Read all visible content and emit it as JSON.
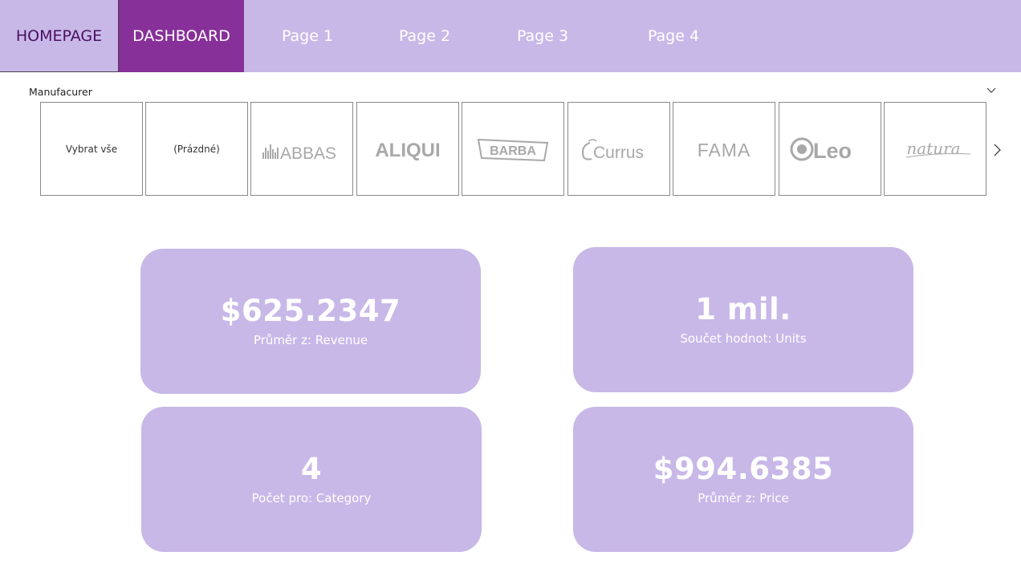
{
  "nav": {
    "home": "HOMEPAGE",
    "dashboard": "DASHBOARD",
    "pages": [
      "Page 1",
      "Page 2",
      "Page 3",
      "Page 4"
    ]
  },
  "slicer": {
    "title": "Manufacurer",
    "select_all": "Vybrat vše",
    "empty": "(Prázdné)",
    "brands": [
      "ABBAS",
      "ALIQUI",
      "BARBA",
      "Currus",
      "FAMA",
      "Leo",
      "natura"
    ]
  },
  "cards": [
    {
      "value": "$625.2347",
      "label": "Průměr z: Revenue"
    },
    {
      "value": "1 mil.",
      "label": "Součet hodnot: Units"
    },
    {
      "value": "4",
      "label": "Počet pro: Category"
    },
    {
      "value": "$994.6385",
      "label": "Průměr z: Price"
    }
  ],
  "colors": {
    "accent_light": "#c8b8e8",
    "accent_dark": "#88309a",
    "logo_gray": "#a8a8a8"
  }
}
